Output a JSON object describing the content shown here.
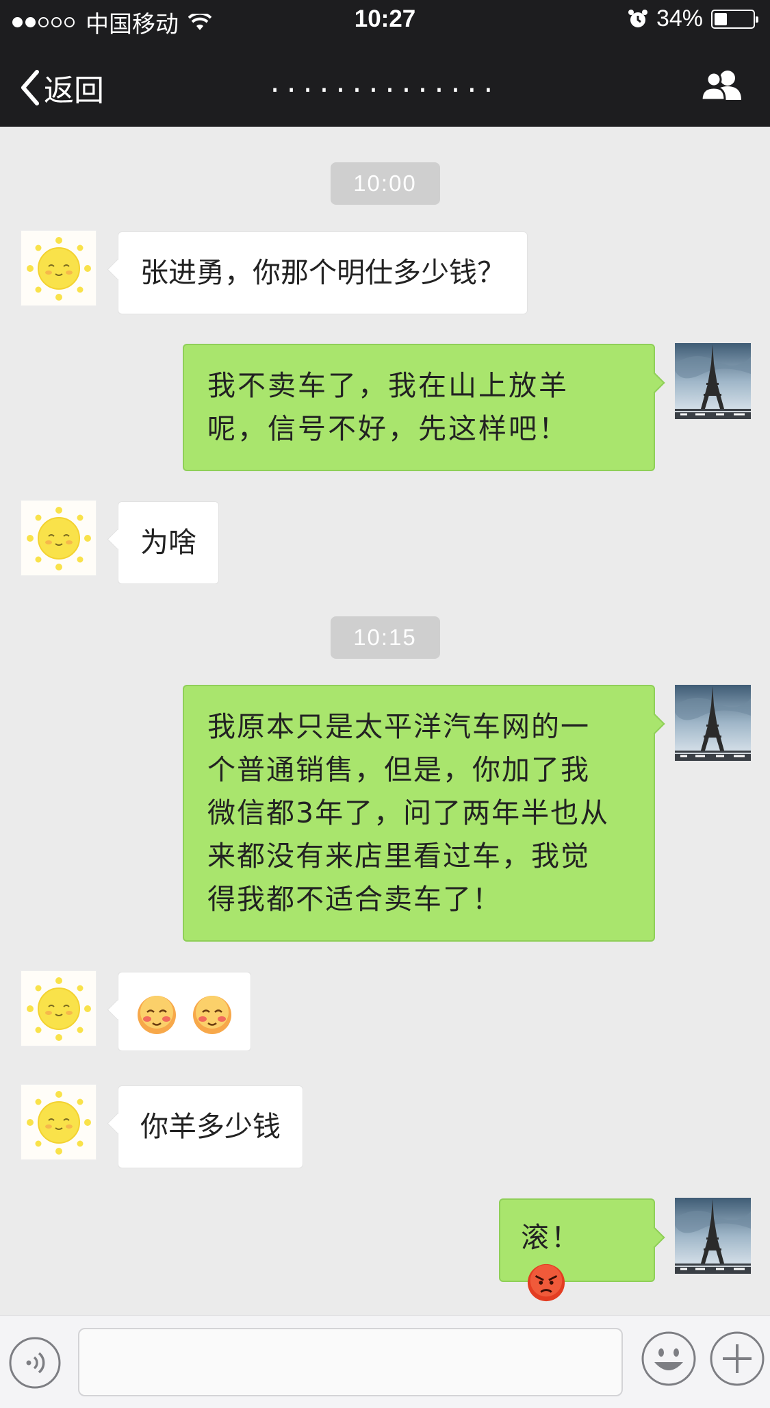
{
  "status_bar": {
    "carrier": "中国移动",
    "time": "10:27",
    "battery": "34%",
    "battery_level": 0.34,
    "signal_strength": 2,
    "icons": [
      "signal-dots-icon",
      "wifi-icon",
      "alarm-icon",
      "battery-icon"
    ]
  },
  "nav": {
    "back_label": "返回",
    "title": "..............",
    "icons": [
      "back-chevron-icon",
      "contacts-icon"
    ]
  },
  "messages": {
    "ts1": "10:00",
    "m1": "张进勇，你那个明仕多少钱？",
    "m2_line1": "我不卖车了，我在山上放羊",
    "m2_line2": "呢，信号不好，先这样吧！",
    "m3": "为啥",
    "ts2": "10:15",
    "m4_line1": "我原本只是太平洋汽车网的一",
    "m4_line2": "个普通销售，但是，你加了我",
    "m4_line3": "微信都3年了，问了两年半也从",
    "m4_line4": "来都没有来店里看过车，我觉",
    "m4_line5": "得我都不适合卖车了！",
    "m5_emoji": [
      "blush-face-emoji",
      "blush-face-emoji"
    ],
    "m6": "你羊多少钱",
    "m7": "滚！",
    "m7_emoji": "angry-face-emoji"
  },
  "input_bar": {
    "placeholder": "",
    "icons": [
      "voice-icon",
      "emoji-icon",
      "plus-icon"
    ]
  },
  "colors": {
    "header_bg": "#1d1d1f",
    "chat_bg": "#ebebeb",
    "outgoing_bubble": "#a9e56d",
    "incoming_bubble": "#ffffff"
  }
}
